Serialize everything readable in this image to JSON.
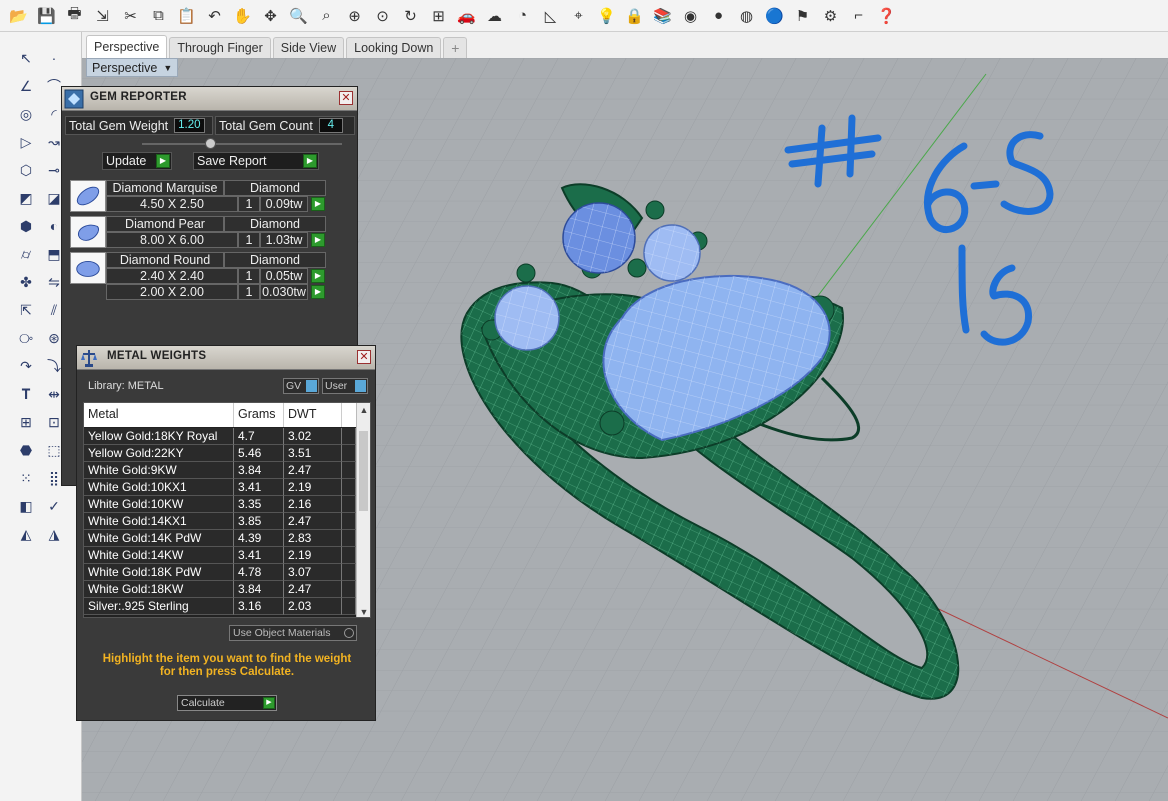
{
  "toolbar": {
    "icons": [
      "open-icon",
      "save-icon",
      "print-icon",
      "import-icon",
      "cut-icon",
      "copy-icon",
      "paste-icon",
      "undo-icon",
      "pan-icon",
      "rotate-view-icon",
      "zoom-icon",
      "zoom-window-icon",
      "zoom-extents-icon",
      "zoom-selected-icon",
      "redo-view-icon",
      "four-view-icon",
      "car-icon",
      "render-icon",
      "ellipse-tool-icon",
      "fillet-icon",
      "snap-icon",
      "light-icon",
      "lock-icon",
      "layer-icon",
      "color-wheel-icon",
      "material-icon",
      "sphere-icon",
      "render-sphere-icon",
      "flag-icon",
      "gear-icon",
      "dimension-icon",
      "help-icon"
    ]
  },
  "tabs": [
    {
      "label": "Perspective",
      "active": true
    },
    {
      "label": "Through Finger",
      "active": false
    },
    {
      "label": "Side View",
      "active": false
    },
    {
      "label": "Looking Down",
      "active": false
    }
  ],
  "viewport": {
    "label": "Perspective",
    "annotations": [
      "# 6-5",
      "15"
    ]
  },
  "gem_reporter": {
    "title": "GEM REPORTER",
    "total_weight_label": "Total Gem Weight",
    "total_weight_value": "1.20",
    "total_count_label": "Total Gem Count",
    "total_count_value": "4",
    "update_label": "Update",
    "save_report_label": "Save Report",
    "gems": [
      {
        "name": "Diamond Marquise",
        "material": "Diamond",
        "rows": [
          {
            "size": "4.50 X 2.50",
            "qty": "1",
            "weight": "0.09tw"
          }
        ]
      },
      {
        "name": "Diamond Pear",
        "material": "Diamond",
        "rows": [
          {
            "size": "8.00 X 6.00",
            "qty": "1",
            "weight": "1.03tw"
          }
        ]
      },
      {
        "name": "Diamond Round",
        "material": "Diamond",
        "rows": [
          {
            "size": "2.40 X 2.40",
            "qty": "1",
            "weight": "0.05tw"
          },
          {
            "size": "2.00 X 2.00",
            "qty": "1",
            "weight": "0.030tw"
          }
        ]
      }
    ]
  },
  "metal_weights": {
    "title": "METAL WEIGHTS",
    "library_label": "Library: METAL",
    "gv_label": "GV",
    "user_label": "User",
    "columns": [
      "Metal",
      "Grams",
      "DWT"
    ],
    "rows": [
      [
        "Yellow Gold:18KY Royal",
        "4.7",
        "3.02"
      ],
      [
        "Yellow Gold:22KY",
        "5.46",
        "3.51"
      ],
      [
        "White Gold:9KW",
        "3.84",
        "2.47"
      ],
      [
        "White Gold:10KX1",
        "3.41",
        "2.19"
      ],
      [
        "White Gold:10KW",
        "3.35",
        "2.16"
      ],
      [
        "White Gold:14KX1",
        "3.85",
        "2.47"
      ],
      [
        "White Gold:14K PdW",
        "4.39",
        "2.83"
      ],
      [
        "White Gold:14KW",
        "3.41",
        "2.19"
      ],
      [
        "White Gold:18K PdW",
        "4.78",
        "3.07"
      ],
      [
        "White Gold:18KW",
        "3.84",
        "2.47"
      ],
      [
        "Silver:.925 Sterling",
        "3.16",
        "2.03"
      ]
    ],
    "use_object_label": "Use Object Materials",
    "hint_line1": "Highlight the item you want to find the weight",
    "hint_line2": "for then press Calculate.",
    "calculate_label": "Calculate"
  },
  "colors": {
    "viewport_bg": "#a8acb0",
    "metal_green": "#1e7a52",
    "gem_blue": "#8fb4f0",
    "annotation_blue": "#1f6fd6",
    "hint_yellow": "#f2b322"
  }
}
